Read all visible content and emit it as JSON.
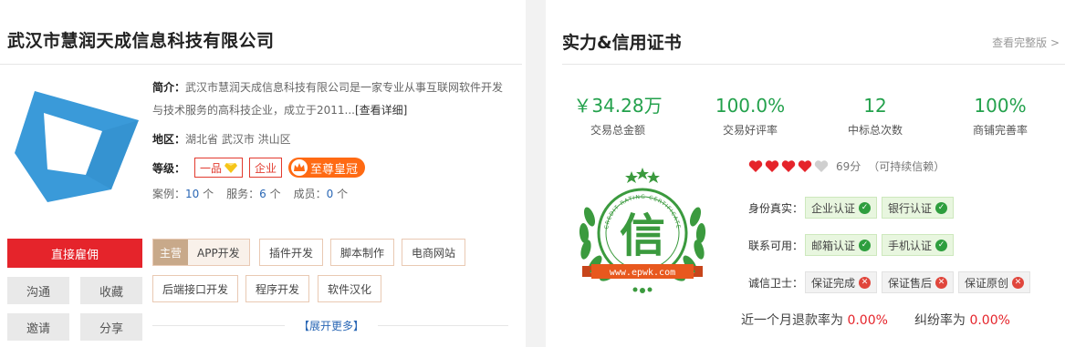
{
  "company": {
    "name": "武汉市慧润天成信息科技有限公司",
    "intro_label": "简介：",
    "intro_text": "武汉市慧润天成信息科技有限公司是一家专业从事互联网软件开发与技术服务的高科技企业，成立于2011...",
    "intro_more": "[查看详细]",
    "region_label": "地区：",
    "region_value": "湖北省 武汉市 洪山区",
    "grade_label": "等级：",
    "grade_badges": [
      "一品",
      "企业"
    ],
    "crown_badge": "至尊皇冠",
    "stats": {
      "cases_label": "案例：",
      "cases_value": "10",
      "cases_unit": "个",
      "services_label": "服务：",
      "services_value": "6",
      "services_unit": "个",
      "members_label": "成员：",
      "members_value": "0",
      "members_unit": "个"
    }
  },
  "actions": {
    "hire": "直接雇佣",
    "chat": "沟通",
    "favorite": "收藏",
    "invite": "邀请",
    "share": "分享"
  },
  "skills": {
    "main_label": "主营",
    "main_value": "APP开发",
    "tags": [
      "插件开发",
      "脚本制作",
      "电商网站",
      "后端接口开发",
      "程序开发",
      "软件汉化"
    ],
    "expand": "【展开更多】"
  },
  "credit": {
    "title": "实力&信用证书",
    "view_all": "查看完整版 >",
    "metrics": [
      {
        "value": "￥34.28万",
        "label": "交易总金额"
      },
      {
        "value": "100.0%",
        "label": "交易好评率"
      },
      {
        "value": "12",
        "label": "中标总次数"
      },
      {
        "value": "100%",
        "label": "商铺完善率"
      }
    ],
    "seal": {
      "char": "信",
      "ring_text": "CREDIT RATING CERTIFICATE",
      "url": "www.epwk.com"
    },
    "hearts_filled": 4,
    "hearts_total": 5,
    "score": "69分",
    "score_note": "（可持续信赖）",
    "identity_label": "身份真实：",
    "identity": [
      "企业认证",
      "银行认证"
    ],
    "contact_label": "联系可用：",
    "contact": [
      "邮箱认证",
      "手机认证"
    ],
    "guard_label": "诚信卫士：",
    "guard": [
      "保证完成",
      "保证售后",
      "保证原创"
    ],
    "refund_label": "近一个月退款率为",
    "refund_value": "0.00%",
    "dispute_label": "纠纷率为",
    "dispute_value": "0.00%"
  },
  "colors": {
    "accent_red": "#e5242b",
    "green": "#23a14c",
    "logo_blue": "#3a9ad9",
    "link_blue": "#2a67b5"
  }
}
